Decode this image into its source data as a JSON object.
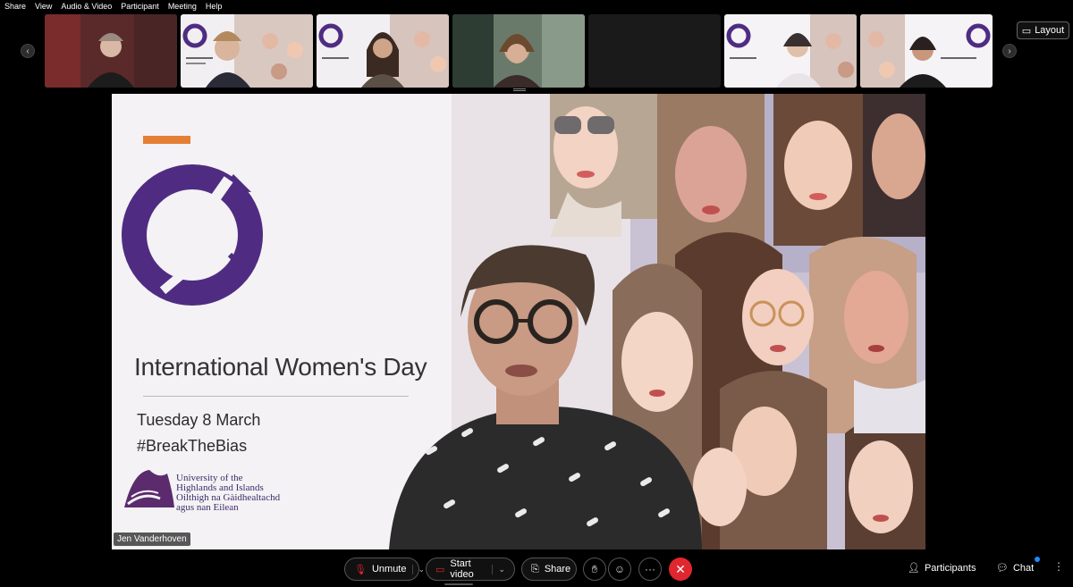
{
  "menu": [
    "Share",
    "View",
    "Audio & Video",
    "Participant",
    "Meeting",
    "Help"
  ],
  "layout_button": {
    "label": "Layout",
    "icon": "layout-icon"
  },
  "filmstrip": {
    "prev_icon": "chevron-left-icon",
    "next_icon": "chevron-right-icon"
  },
  "slide": {
    "title": "International Women's Day",
    "date": "Tuesday 8 March",
    "hashtag": "#BreakTheBias",
    "university": [
      "University of the",
      "Highlands and Islands",
      "Oilthigh na Gàidhealtachd",
      "agus nan Eilean"
    ]
  },
  "speaker": {
    "name": "Jen Vanderhoven"
  },
  "controls": {
    "unmute": "Unmute",
    "start_video": "Start video",
    "share": "Share",
    "participants": "Participants",
    "chat": "Chat",
    "more_glyph": "···",
    "end_glyph": "✕"
  },
  "colors": {
    "accent_purple": "#4f2c82",
    "accent_orange": "#e47f36",
    "end_red": "#e0262e"
  }
}
